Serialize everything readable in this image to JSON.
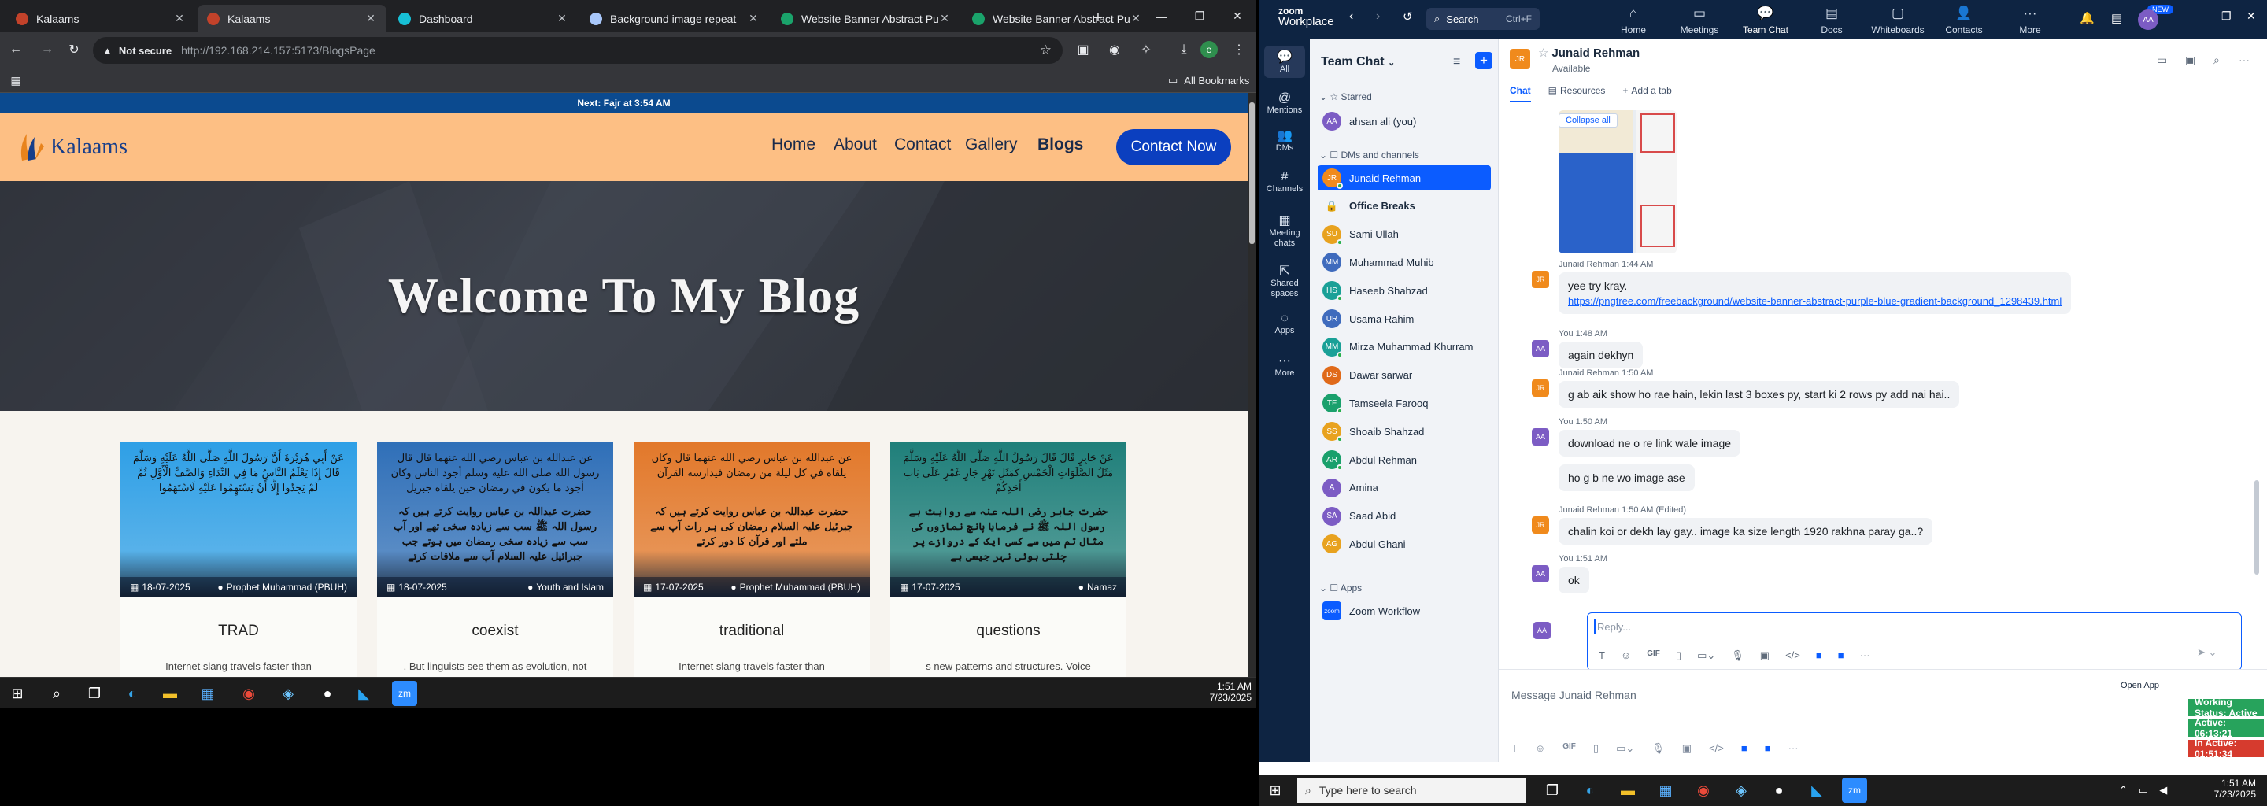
{
  "browser": {
    "tabs": [
      {
        "title": "Kalaams",
        "color": "#c2422a"
      },
      {
        "title": "Kalaams",
        "color": "#c2422a"
      },
      {
        "title": "Dashboard",
        "color": "#17c0d6"
      },
      {
        "title": "Background image repeat",
        "color": "#a8c7fa"
      },
      {
        "title": "Website Banner Abstract Pu",
        "color": "#1aa36b"
      },
      {
        "title": "Website Banner Abstract Pu",
        "color": "#1aa36b"
      }
    ],
    "security_label": "Not secure",
    "url": "http://192.168.214.157:5173/BlogsPage",
    "bookmarks_label": "All Bookmarks"
  },
  "site": {
    "prayer_banner": "Next: Fajr at 3:54 AM",
    "brand": "Kalaams",
    "nav": [
      "Home",
      "About",
      "Contact",
      "Gallery",
      "Blogs"
    ],
    "cta": "Contact Now",
    "hero_title": "Welcome To My Blog",
    "cards": [
      {
        "arabic": "عَنْ أَبِي هُرَيْرَةَ أَنَّ رَسُولَ اللَّهِ صَلَّى اللَّهُ عَلَيْهِ وَسَلَّمَ قَالَ إِذَا يَعْلَمُ النَّاسُ مَا فِي النِّدَاءِ وَالصَّفِّ الْأَوَّلِ ثُمَّ لَمْ يَجِدُوا إِلَّا أَنْ يَسْتَهِمُوا عَلَيْهِ لَاسْتَهَمُوا",
        "urdu": "",
        "date": "18-07-2025",
        "tag": "Prophet Muhammad (PBUH)",
        "title": "TRAD",
        "desc": "Internet slang travels faster than",
        "bg": "#2e9fe6"
      },
      {
        "arabic": "عن عبدالله بن عباس رضي الله عنهما قال قال رسول الله صلى الله عليه وسلم أجود الناس وكان أجود ما يكون في رمضان حين يلقاه جبريل",
        "urdu": "حضرت عبداللہ بن عباس روایت کرتے ہیں کہ رسول اللہ ﷺ سب سے زیادہ سخی تھے اور آپ سب سے زیادہ سخی رمضان میں ہوتے جب جبرائیل علیہ السلام آپ سے ملاقات کرتے",
        "date": "18-07-2025",
        "tag": "Youth and Islam",
        "title": "coexist",
        "desc": ". But linguists see them as evolution, not",
        "bg": "#2f6fb8"
      },
      {
        "arabic": "عن عبدالله بن عباس رضي الله عنهما قال وكان يلقاه في كل ليلة من رمضان فيدارسه القرآن",
        "urdu": "حضرت عبداللہ بن عباس روایت کرتے ہیں کہ جبرئیل علیہ السلام رمضان کی ہر رات آپ سے ملتے اور قرآن کا دور کرتے",
        "date": "17-07-2025",
        "tag": "Prophet Muhammad (PBUH)",
        "title": "traditional",
        "desc": "Internet slang travels faster than",
        "bg": "#e2782a"
      },
      {
        "arabic": "عَنْ جَابِرٍ قَالَ قَالَ رَسُولُ اللَّهِ صَلَّى اللَّهُ عَلَيْهِ وَسَلَّمَ مَثَلُ الصَّلَوَاتِ الْخَمْسِ كَمَثَلِ نَهْرٍ جَارٍ غَمْرٍ عَلَى بَابِ أَحَدِكُمْ",
        "urdu": "حضرت جابر رضی اللہ عنہ سے روایت ہے رسول اللہ ﷺ نے فرمایا پانچ نمازوں کی مثال تم میں سے کسی ایک کے دروازے پر چلتی ہوئی نہر جیسی ہے",
        "date": "17-07-2025",
        "tag": "Namaz",
        "title": "questions",
        "desc": "s new patterns and structures. Voice",
        "bg": "#1f7f7a"
      }
    ]
  },
  "taskbar_left": {
    "time": "1:51 AM",
    "date": "7/23/2025"
  },
  "zoom": {
    "brand_top": "zoom",
    "brand_bottom": "Workplace",
    "search_label": "Search",
    "search_shortcut": "Ctrl+F",
    "apps": [
      {
        "label": "Home",
        "icon": "⌂"
      },
      {
        "label": "Meetings",
        "icon": "▭"
      },
      {
        "label": "Team Chat",
        "icon": "💬"
      },
      {
        "label": "Docs",
        "icon": "▤"
      },
      {
        "label": "Whiteboards",
        "icon": "▢"
      },
      {
        "label": "Contacts",
        "icon": "👤"
      },
      {
        "label": "More",
        "icon": "···"
      }
    ],
    "new_badge": "NEW",
    "user_initials": "AA",
    "rail": [
      {
        "label": "All",
        "icon": "💬"
      },
      {
        "label": "Mentions",
        "icon": "@"
      },
      {
        "label": "DMs",
        "icon": "👥"
      },
      {
        "label": "Channels",
        "icon": "#"
      },
      {
        "label": "Meeting chats",
        "icon": "▦"
      },
      {
        "label": "Shared spaces",
        "icon": "⇱"
      },
      {
        "label": "Apps",
        "icon": "◌"
      },
      {
        "label": "More",
        "icon": "···"
      }
    ],
    "sidebar_title": "Team Chat",
    "starred_label": "Starred",
    "starred": [
      {
        "name": "ahsan ali (you)",
        "initials": "AA",
        "color": "#7c5cc4",
        "online": false
      }
    ],
    "dms_label": "DMs and channels",
    "contacts": [
      {
        "name": "Junaid Rehman",
        "initials": "JR",
        "color": "#f08a1c",
        "online": true,
        "selected": true
      },
      {
        "name": "Office Breaks",
        "initials": "",
        "color": "",
        "online": false,
        "bold": true,
        "lock": true
      },
      {
        "name": "Sami Ullah",
        "initials": "SU",
        "color": "#e8a21f",
        "online": true
      },
      {
        "name": "Muhammad Muhib",
        "initials": "MM",
        "color": "#3f6bbd",
        "online": false
      },
      {
        "name": "Haseeb Shahzad",
        "initials": "HS",
        "color": "#1aa097",
        "online": true
      },
      {
        "name": "Usama Rahim",
        "initials": "UR",
        "color": "#3f6bbd",
        "online": false
      },
      {
        "name": "Mirza Muhammad Khurram",
        "initials": "MM",
        "color": "#1aa097",
        "online": true
      },
      {
        "name": "Dawar sarwar",
        "initials": "DS",
        "color": "#e06a1a",
        "online": false
      },
      {
        "name": "Tamseela Farooq",
        "initials": "TF",
        "color": "#1aa06c",
        "online": true
      },
      {
        "name": "Shoaib Shahzad",
        "initials": "SS",
        "color": "#e8a21f",
        "online": true
      },
      {
        "name": "Abdul Rehman",
        "initials": "AR",
        "color": "#1aa06c",
        "online": true
      },
      {
        "name": "Amina",
        "initials": "A",
        "color": "#7c5cc4",
        "online": false
      },
      {
        "name": "Saad Abid",
        "initials": "SA",
        "color": "#7c5cc4",
        "online": false
      },
      {
        "name": "Abdul Ghani",
        "initials": "AG",
        "color": "#e8a21f",
        "online": false
      }
    ],
    "apps_section_label": "Apps",
    "apps_section": [
      {
        "name": "Zoom Workflow",
        "initials": "zoom",
        "color": "#0b5cff"
      }
    ],
    "chat": {
      "name": "Junaid Rehman",
      "initials": "JR",
      "status": "Available",
      "tabs": [
        "Chat",
        "Resources",
        "Add a tab"
      ],
      "collapse": "Collapse all",
      "messages": [
        {
          "who": "JR",
          "meta": "Junaid Rehman 1:44 AM",
          "text": "yee try kray.",
          "link": "https://pngtree.com/freebackground/website-banner-abstract-purple-blue-gradient-background_1298439.html"
        },
        {
          "who": "AA",
          "meta": "You 1:48 AM",
          "text": "again dekhyn"
        },
        {
          "who": "JR",
          "meta": "Junaid Rehman 1:50 AM",
          "text": "g ab aik show ho rae hain, lekin last 3 boxes py, start ki 2 rows py add nai hai.."
        },
        {
          "who": "AA",
          "meta": "You 1:50 AM",
          "text": "download ne o re link wale image"
        },
        {
          "who": "AA",
          "meta": "",
          "text": "ho g b ne wo image ase"
        },
        {
          "who": "JR",
          "meta": "Junaid Rehman 1:50 AM (Edited)",
          "text": "chalin koi or dekh lay gay.. image ka size length 1920 rakhna paray ga..?"
        },
        {
          "who": "AA",
          "meta": "You 1:51 AM",
          "text": "ok"
        }
      ],
      "reply_placeholder": "Reply...",
      "compose_placeholder": "Message Junaid Rehman",
      "open_app": "Open App"
    },
    "status_boxes": [
      {
        "text": "Working Status: Active",
        "color": "#27a35c"
      },
      {
        "text": "Active: 06:13:21",
        "color": "#27a35c"
      },
      {
        "text": "In Active: 01:51:34",
        "color": "#d63b2e"
      }
    ]
  },
  "taskbar_right": {
    "search_placeholder": "Type here to search",
    "time": "1:51 AM",
    "date": "7/23/2025"
  }
}
